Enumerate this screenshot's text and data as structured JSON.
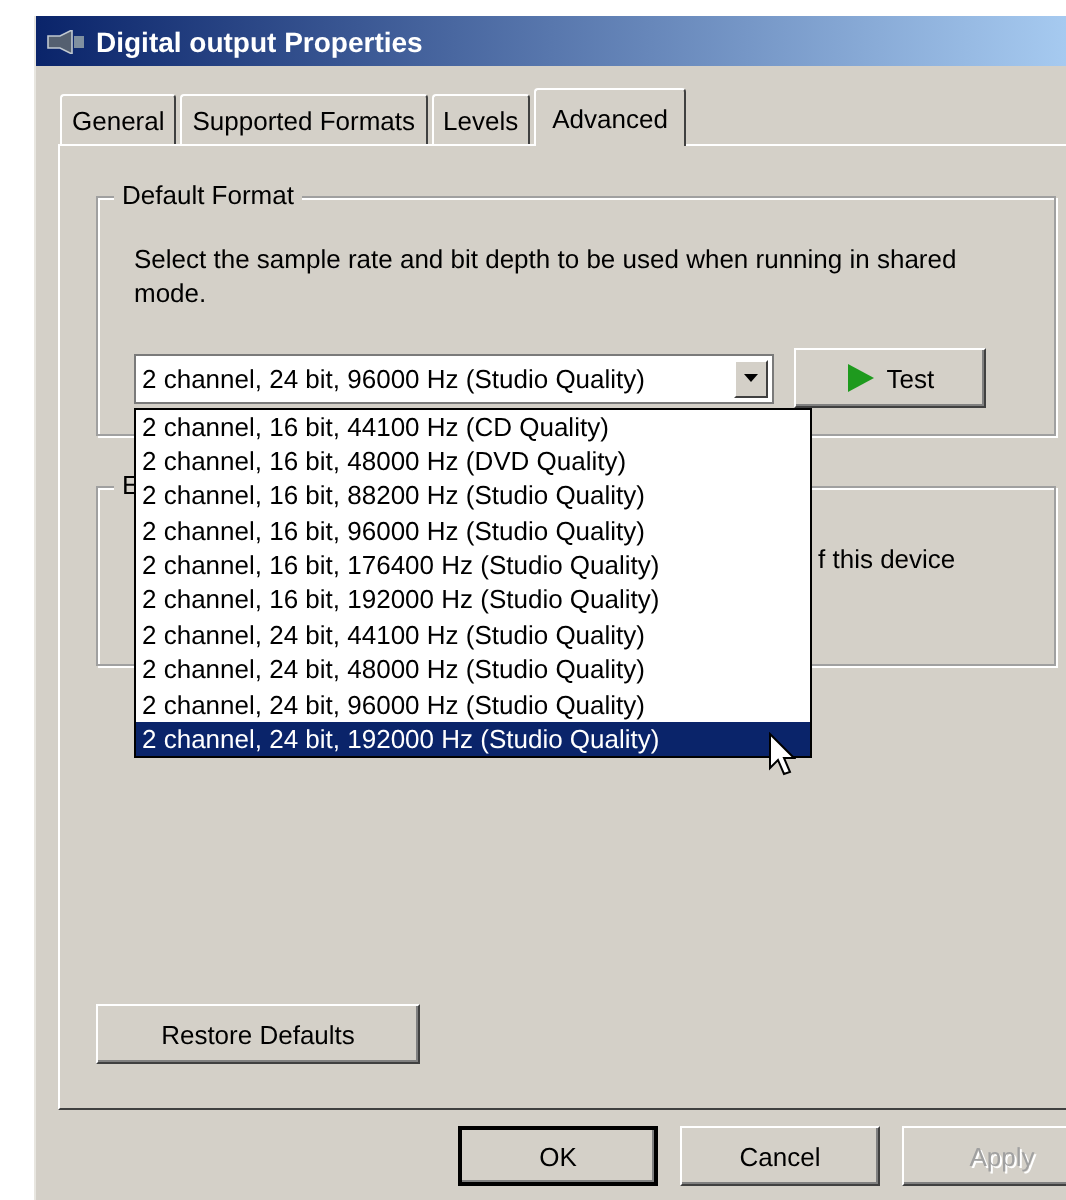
{
  "window": {
    "title": "Digital output Properties"
  },
  "tabs": [
    {
      "label": "General",
      "selected": false
    },
    {
      "label": "Supported Formats",
      "selected": false
    },
    {
      "label": "Levels",
      "selected": false
    },
    {
      "label": "Advanced",
      "selected": true
    }
  ],
  "default_format": {
    "label": "Default Format",
    "description": "Select the sample rate and bit depth to be used when running in shared mode.",
    "combo_value": "2 channel, 24 bit, 96000 Hz (Studio Quality)",
    "expanded": true,
    "options": [
      {
        "label": "2 channel, 16 bit, 44100 Hz (CD Quality)",
        "selected": false
      },
      {
        "label": "2 channel, 16 bit, 48000 Hz (DVD Quality)",
        "selected": false
      },
      {
        "label": "2 channel, 16 bit, 88200 Hz (Studio Quality)",
        "selected": false
      },
      {
        "label": "2 channel, 16 bit, 96000 Hz (Studio Quality)",
        "selected": false
      },
      {
        "label": "2 channel, 16 bit, 176400 Hz (Studio Quality)",
        "selected": false
      },
      {
        "label": "2 channel, 16 bit, 192000 Hz (Studio Quality)",
        "selected": false
      },
      {
        "label": "2 channel, 24 bit, 44100 Hz (Studio Quality)",
        "selected": false
      },
      {
        "label": "2 channel, 24 bit, 48000 Hz (Studio Quality)",
        "selected": false
      },
      {
        "label": "2 channel, 24 bit, 96000 Hz (Studio Quality)",
        "selected": false
      },
      {
        "label": "2 channel, 24 bit, 192000 Hz (Studio Quality)",
        "selected": true
      }
    ],
    "test_button": "Test"
  },
  "second_group": {
    "label": "E",
    "text": "f this device"
  },
  "restore_button": "Restore Defaults",
  "buttons": [
    {
      "label": "OK",
      "default": true,
      "disabled": false
    },
    {
      "label": "Cancel",
      "default": false,
      "disabled": false
    },
    {
      "label": "Apply",
      "default": false,
      "disabled": true
    }
  ]
}
